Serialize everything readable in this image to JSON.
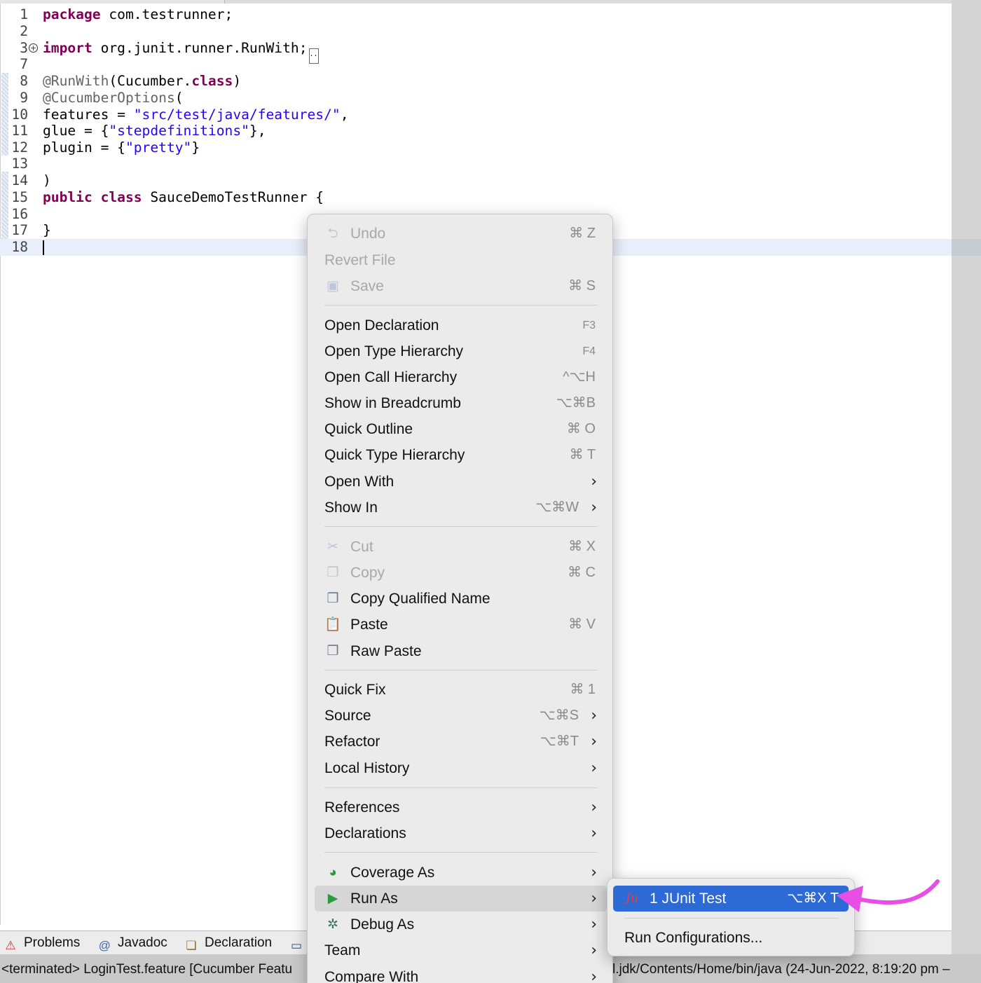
{
  "editor": {
    "lines": [
      {
        "n": "1",
        "html_parts": [
          {
            "t": "package",
            "c": "kw"
          },
          {
            "t": " com.testrunner;",
            "c": ""
          }
        ]
      },
      {
        "n": "2",
        "html_parts": []
      },
      {
        "n": "3",
        "html_parts": [
          {
            "t": "import",
            "c": "kw"
          },
          {
            "t": " org.junit.runner.RunWith;",
            "c": ""
          }
        ],
        "folded": true
      },
      {
        "n": "7",
        "html_parts": []
      },
      {
        "n": "8",
        "html_parts": [
          {
            "t": "@RunWith",
            "c": "ann"
          },
          {
            "t": "(Cucumber.",
            "c": ""
          },
          {
            "t": "class",
            "c": "kw"
          },
          {
            "t": ")",
            "c": ""
          }
        ]
      },
      {
        "n": "9",
        "html_parts": [
          {
            "t": "@CucumberOptions",
            "c": "ann"
          },
          {
            "t": "(",
            "c": ""
          }
        ]
      },
      {
        "n": "10",
        "html_parts": [
          {
            "t": "features = ",
            "c": ""
          },
          {
            "t": "\"src/test/java/features/\"",
            "c": "str"
          },
          {
            "t": ",",
            "c": ""
          }
        ]
      },
      {
        "n": "11",
        "html_parts": [
          {
            "t": "glue = {",
            "c": ""
          },
          {
            "t": "\"stepdefinitions\"",
            "c": "str"
          },
          {
            "t": "},",
            "c": ""
          }
        ]
      },
      {
        "n": "12",
        "html_parts": [
          {
            "t": "plugin = {",
            "c": ""
          },
          {
            "t": "\"pretty\"",
            "c": "str"
          },
          {
            "t": "}",
            "c": ""
          }
        ]
      },
      {
        "n": "13",
        "html_parts": []
      },
      {
        "n": "14",
        "html_parts": [
          {
            "t": ")",
            "c": ""
          }
        ]
      },
      {
        "n": "15",
        "html_parts": [
          {
            "t": "public",
            "c": "kw"
          },
          {
            "t": " ",
            "c": ""
          },
          {
            "t": "class",
            "c": "kw"
          },
          {
            "t": " SauceDemoTestRunner {",
            "c": ""
          }
        ]
      },
      {
        "n": "16",
        "html_parts": []
      },
      {
        "n": "17",
        "html_parts": [
          {
            "t": "}",
            "c": ""
          }
        ]
      },
      {
        "n": "18",
        "html_parts": []
      }
    ]
  },
  "context_menu": {
    "items": [
      {
        "label": "Undo",
        "shortcut": "⌘ Z",
        "disabled": true,
        "icon": "undo-icon",
        "glyph": "⮌"
      },
      {
        "label": "Revert File",
        "shortcut": "",
        "disabled": true
      },
      {
        "label": "Save",
        "shortcut": "⌘ S",
        "disabled": true,
        "icon": "save-icon",
        "glyph": "▣"
      },
      {
        "sep": true
      },
      {
        "label": "Open Declaration",
        "shortcut": "F3"
      },
      {
        "label": "Open Type Hierarchy",
        "shortcut": "F4"
      },
      {
        "label": "Open Call Hierarchy",
        "shortcut": "^⌥H"
      },
      {
        "label": "Show in Breadcrumb",
        "shortcut": "⌥⌘B"
      },
      {
        "label": "Quick Outline",
        "shortcut": "⌘ O"
      },
      {
        "label": "Quick Type Hierarchy",
        "shortcut": "⌘ T"
      },
      {
        "label": "Open With",
        "shortcut": "",
        "submenu": true
      },
      {
        "label": "Show In",
        "shortcut": "⌥⌘W",
        "submenu": true
      },
      {
        "sep": true
      },
      {
        "label": "Cut",
        "shortcut": "⌘ X",
        "disabled": true,
        "icon": "scissors-icon",
        "glyph": "✂"
      },
      {
        "label": "Copy",
        "shortcut": "⌘ C",
        "disabled": true,
        "icon": "copy-icon",
        "glyph": "❐"
      },
      {
        "label": "Copy Qualified Name",
        "shortcut": "",
        "icon": "copy-qualified-icon",
        "glyph": "❐"
      },
      {
        "label": "Paste",
        "shortcut": "⌘ V",
        "icon": "clipboard-icon",
        "glyph": "📋"
      },
      {
        "label": "Raw Paste",
        "shortcut": "",
        "icon": "raw-paste-icon",
        "glyph": "❐"
      },
      {
        "sep": true
      },
      {
        "label": "Quick Fix",
        "shortcut": "⌘ 1"
      },
      {
        "label": "Source",
        "shortcut": "⌥⌘S",
        "submenu": true
      },
      {
        "label": "Refactor",
        "shortcut": "⌥⌘T",
        "submenu": true
      },
      {
        "label": "Local History",
        "shortcut": "",
        "submenu": true
      },
      {
        "sep": true
      },
      {
        "label": "References",
        "shortcut": "",
        "submenu": true
      },
      {
        "label": "Declarations",
        "shortcut": "",
        "submenu": true
      },
      {
        "sep": true
      },
      {
        "label": "Coverage As",
        "shortcut": "",
        "submenu": true,
        "icon": "coverage-icon",
        "glyph": "◕"
      },
      {
        "label": "Run As",
        "shortcut": "",
        "submenu": true,
        "icon": "run-icon",
        "glyph": "▶",
        "active": true
      },
      {
        "label": "Debug As",
        "shortcut": "",
        "submenu": true,
        "icon": "debug-bug-icon",
        "glyph": "✲"
      },
      {
        "label": "Team",
        "shortcut": "",
        "submenu": true
      },
      {
        "label": "Compare With",
        "shortcut": "",
        "submenu": true
      }
    ]
  },
  "run_as_submenu": {
    "selected_label": "1 JUnit Test",
    "selected_shortcut": "⌥⌘X T",
    "junit_icon_text": "Ju",
    "run_configurations": "Run Configurations..."
  },
  "bottom_panel": {
    "tabs": [
      {
        "label": "Problems",
        "icon": "problems-icon",
        "glyph": "⚠"
      },
      {
        "label": "Javadoc",
        "icon": "at-icon",
        "glyph": "@"
      },
      {
        "label": "Declaration",
        "icon": "declaration-icon",
        "glyph": "❏"
      }
    ],
    "console_left": "<terminated> LoginTest.feature [Cucumber Featu",
    "console_right": "l.jdk/Contents/Home/bin/java  (24-Jun-2022, 8:19:20 pm – "
  },
  "colors": {
    "accent": "#2d6ad6",
    "arrow": "#e64ee6",
    "keyword": "#7f0055",
    "string": "#2a00ff"
  }
}
